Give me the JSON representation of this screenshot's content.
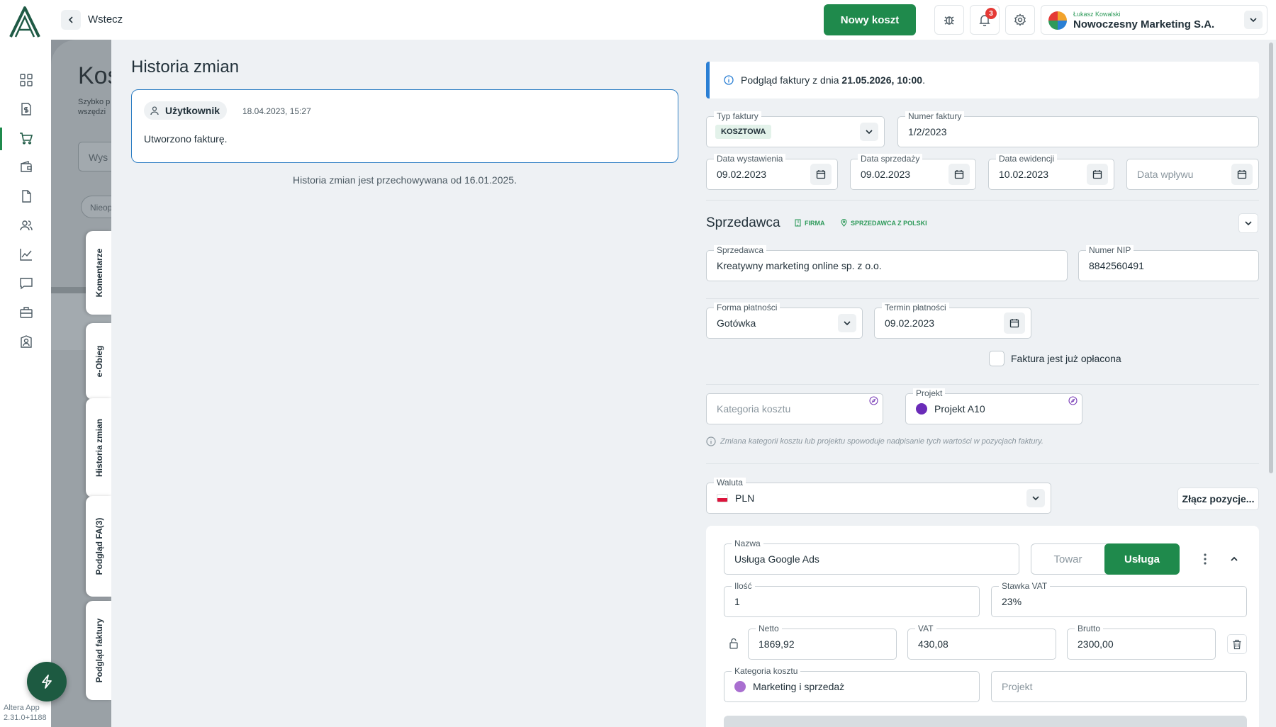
{
  "header": {
    "back_label": "Wstecz",
    "new_cost_label": "Nowy koszt",
    "notifications_count": "3",
    "company_user": "Łukasz Kowalski",
    "company_name": "Nowoczesny Marketing S.A."
  },
  "sidebar": {
    "icons": [
      "grid-icon",
      "invoice-dollar-icon",
      "cart-icon",
      "wallet-icon",
      "document-icon",
      "users-icon",
      "chart-icon",
      "chat-icon",
      "briefcase-icon",
      "contact-icon"
    ],
    "active": "cart-icon",
    "version_line1": "Altera App",
    "version_line2": "2.31.0+1188"
  },
  "background": {
    "title": "Kos",
    "subtitle_line1": "Szybko p",
    "subtitle_line2": "wszędzi",
    "search_placeholder": "Wys",
    "chip": "Nieop"
  },
  "vertical_tabs": [
    "Komentarze",
    "e-Obieg",
    "Historia zmian",
    "Podgląd FA(3)",
    "Podgląd faktury"
  ],
  "history": {
    "title": "Historia zmian",
    "user": "Użytkownik",
    "date": "18.04.2023, 15:27",
    "text": "Utworzono fakturę.",
    "note": "Historia zmian jest przechowywana od 16.01.2025."
  },
  "invoice": {
    "info_prefix": "Podgląd faktury z dnia ",
    "info_date": "21.05.2026, 10:00",
    "info_suffix": ".",
    "type_label": "Typ faktury",
    "type_value": "KOSZTOWA",
    "number_label": "Numer faktury",
    "number_value": "1/2/2023",
    "issue_date_label": "Data wystawienia",
    "issue_date": "09.02.2023",
    "sale_date_label": "Data sprzedaży",
    "sale_date": "09.02.2023",
    "record_date_label": "Data ewidencji",
    "record_date": "10.02.2023",
    "receipt_date_placeholder": "Data wpływu",
    "seller_section": "Sprzedawca",
    "tag_company": "FIRMA",
    "tag_poland": "SPRZEDAWCA Z POLSKI",
    "seller_label": "Sprzedawca",
    "seller_value": "Kreatywny marketing online sp. z o.o.",
    "nip_label": "Numer NIP",
    "nip_value": "8842560491",
    "payment_form_label": "Forma płatności",
    "payment_form_value": "Gotówka",
    "payment_due_label": "Termin płatności",
    "payment_due_value": "09.02.2023",
    "paid_label": "Faktura jest już opłacona",
    "cost_category_placeholder": "Kategoria kosztu",
    "project_label": "Projekt",
    "project_value": "Projekt A10",
    "project_color": "#6a2bb8",
    "hint": "Zmiana kategorii kosztu lub projektu spowoduje nadpisanie tych wartości w pozycjach faktury.",
    "currency_label": "Waluta",
    "currency_value": "PLN",
    "merge_label": "Złącz pozycje..."
  },
  "item": {
    "name_label": "Nazwa",
    "name_value": "Usługa Google Ads",
    "seg_goods": "Towar",
    "seg_service": "Usługa",
    "qty_label": "Ilość",
    "qty_value": "1",
    "vat_rate_label": "Stawka VAT",
    "vat_rate_value": "23%",
    "net_label": "Netto",
    "net_value": "1869,92",
    "vat_label": "VAT",
    "vat_value": "430,08",
    "gross_label": "Brutto",
    "gross_value": "2300,00",
    "category_label": "Kategoria kosztu",
    "category_value": "Marketing i sprzedaż",
    "category_color": "#a96fd0",
    "project_placeholder": "Projekt"
  },
  "colors": {
    "accent_green": "#1f8a4c",
    "info_blue": "#2a7fd4"
  }
}
